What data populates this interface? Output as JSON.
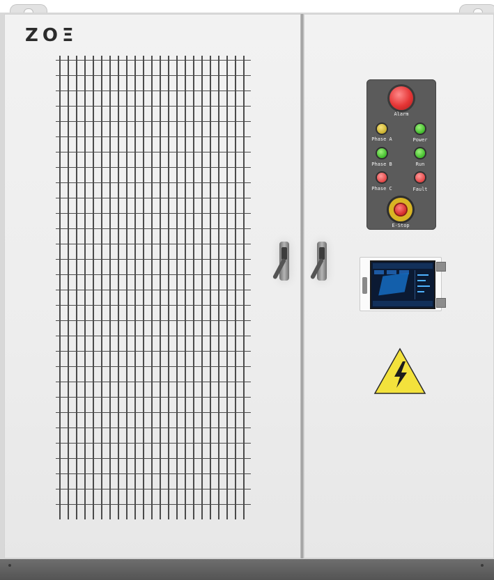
{
  "brand": {
    "logo_text": "ZOΞ"
  },
  "control_panel": {
    "alarm_label": "Alarm",
    "indicators": [
      {
        "label": "Phase A",
        "color": "#c9b02d"
      },
      {
        "label": "Power",
        "color": "#3fbb2a"
      },
      {
        "label": "Phase B",
        "color": "#3fbb2a"
      },
      {
        "label": "Run",
        "color": "#3fbb2a"
      },
      {
        "label": "Phase C",
        "color": "#e34545"
      },
      {
        "label": "Fault",
        "color": "#e34545"
      }
    ],
    "estop_label": "E-Stop"
  },
  "hazard_sign": {
    "icon": "high-voltage-icon",
    "color": "#f3e23c"
  },
  "colors": {
    "panel": "#5b5b5b",
    "alarm": "#e53535",
    "base": "#5e5e5e"
  }
}
